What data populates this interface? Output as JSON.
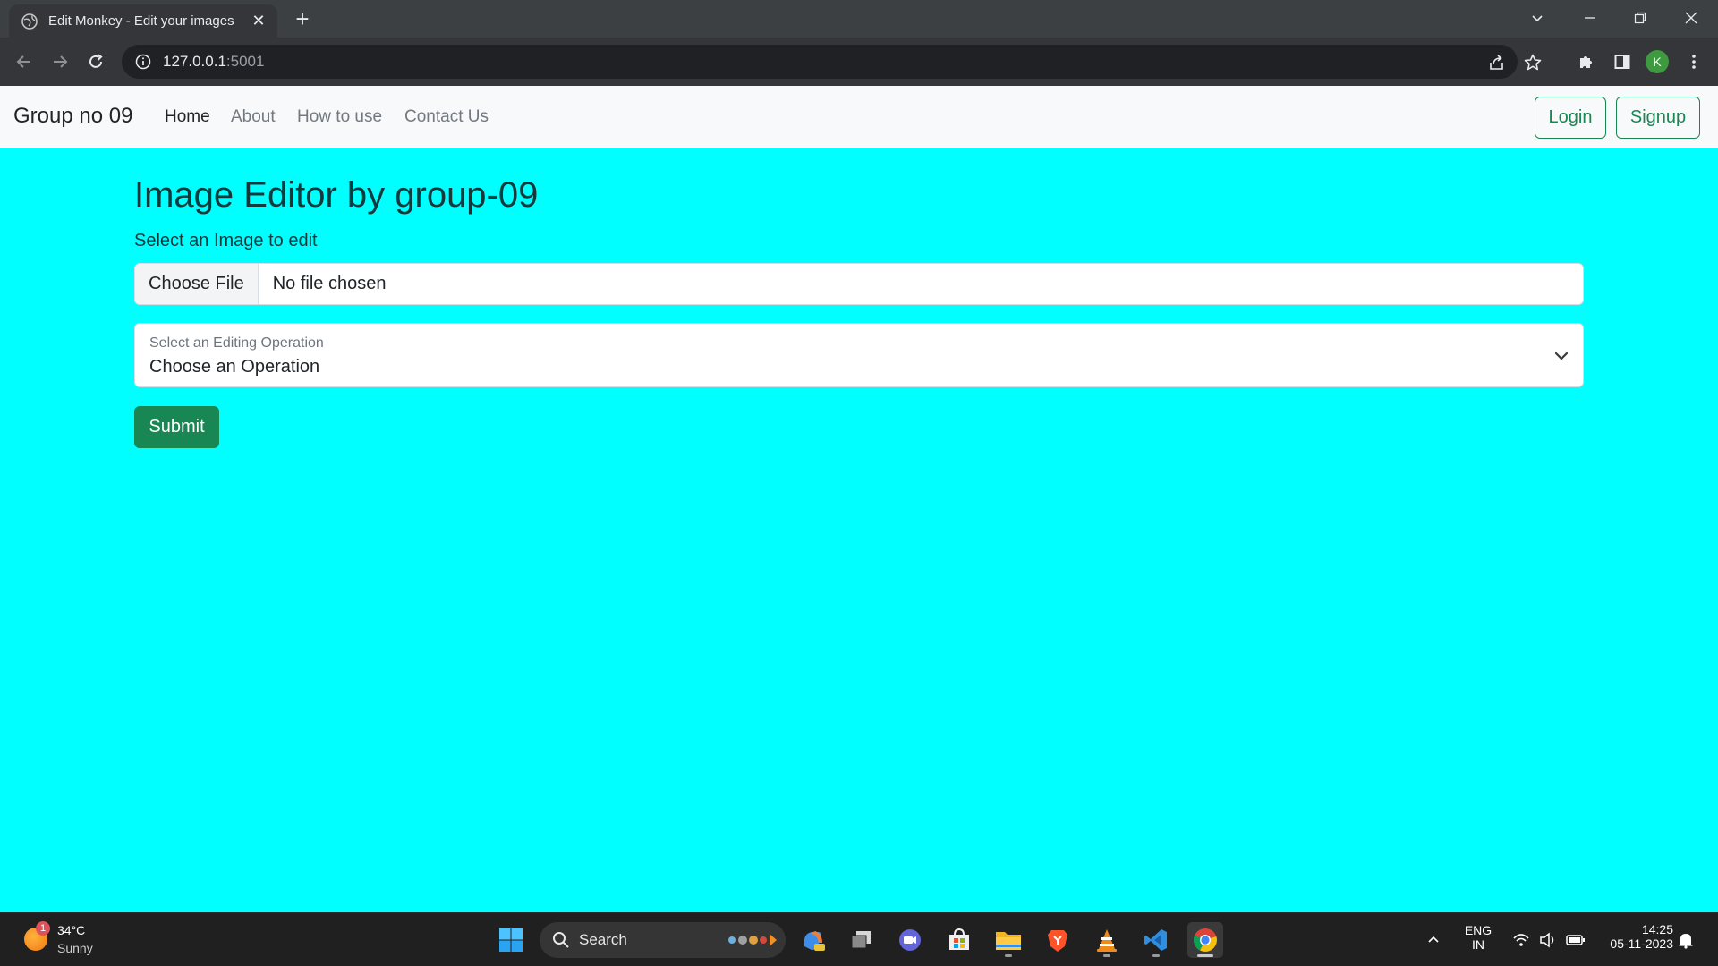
{
  "browser": {
    "tab_title": "Edit Monkey - Edit your images",
    "url_host": "127.0.0.1",
    "url_port": ":5001",
    "profile_initial": "K"
  },
  "navbar": {
    "brand": "Group no 09",
    "links": [
      "Home",
      "About",
      "How to use",
      "Contact Us"
    ],
    "login_label": "Login",
    "signup_label": "Signup"
  },
  "main": {
    "heading": "Image Editor by group-09",
    "file_label": "Select an Image to edit",
    "file_button": "Choose File",
    "file_status": "No file chosen",
    "select_label": "Select an Editing Operation",
    "select_value": "Choose an Operation",
    "submit_label": "Submit"
  },
  "taskbar": {
    "weather_temp": "34°C",
    "weather_cond": "Sunny",
    "weather_badge": "1",
    "search_label": "Search",
    "lang_top": "ENG",
    "lang_bottom": "IN",
    "time": "14:25",
    "date": "05-11-2023"
  },
  "colors": {
    "page_background": "#00ffff",
    "accent_green": "#198754",
    "heading_text": "#123a3d",
    "navbar_background": "#f8f9fa"
  }
}
